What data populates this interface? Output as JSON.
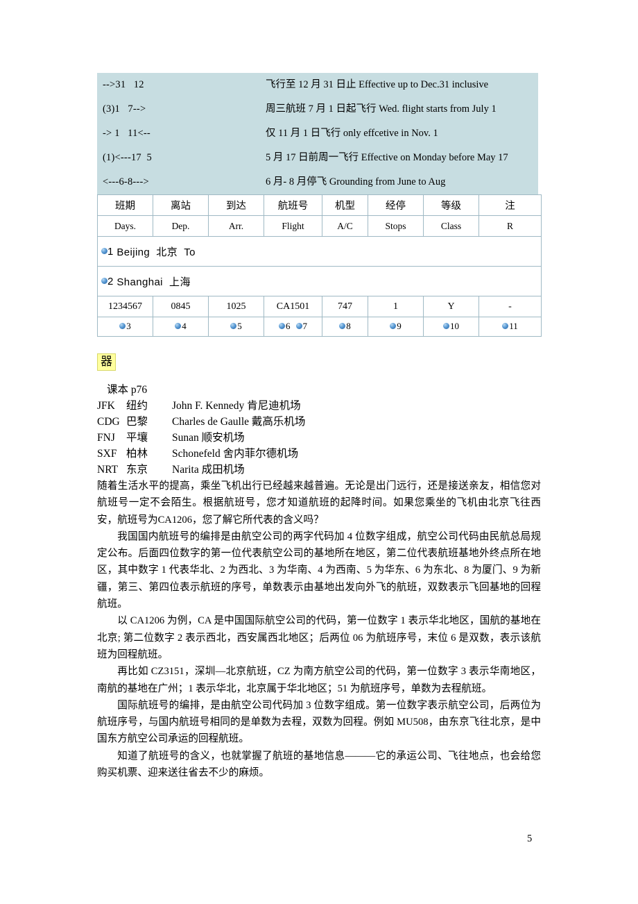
{
  "legend": {
    "rows": [
      {
        "code": "-->31   12",
        "desc": "飞行至 12 月 31 日止  Effective up to Dec.31 inclusive"
      },
      {
        "code": "(3)1   7-->",
        "desc": "周三航班 7 月 1 日起飞行  Wed. flight starts from July 1"
      },
      {
        "code": "-> 1   11<--",
        "desc": "仅 11 月 1 日飞行  only effcetive in Nov. 1"
      },
      {
        "code": "(1)<---17  5",
        "desc": "5 月 17 日前周一飞行  Effective on Monday before May 17"
      },
      {
        "code": "<---6-8--->",
        "desc": "6 月- 8 月停飞  Grounding from June to Aug"
      }
    ]
  },
  "table": {
    "headers_cn": [
      "班期",
      "离站",
      "到达",
      "航班号",
      "机型",
      "经停",
      "等级",
      "注"
    ],
    "headers_en": [
      "Days.",
      "Dep.",
      "Arr.",
      "Flight",
      "A/C",
      "Stops",
      "Class",
      "R"
    ],
    "origin_row": {
      "marker": "1",
      "text": "Beijing  北京  To"
    },
    "destination_row": {
      "marker": "2",
      "text": "Shanghai  上海"
    },
    "data_row": [
      "1234567",
      "0845",
      "1025",
      "CA1501",
      "747",
      "1",
      "Y",
      "-"
    ],
    "marker_row": [
      "3",
      "4",
      "5",
      "6",
      "7",
      "8",
      "9",
      "10",
      "11"
    ]
  },
  "icon": {
    "glyph": "器",
    "bg": "#ffff9e"
  },
  "codes": {
    "book_ref": "课本 p76",
    "items": [
      {
        "abbr": "JFK",
        "city": "纽约",
        "full": "John F. Kennedy  肯尼迪机场"
      },
      {
        "abbr": "CDG",
        "city": "巴黎",
        "full": "Charles de Gaulle  戴高乐机场"
      },
      {
        "abbr": "FNJ",
        "city": "平壤",
        "full": "Sunan  顺安机场"
      },
      {
        "abbr": "SXF",
        "city": "柏林",
        "full": "Schonefeld 舍内菲尔德机场"
      },
      {
        "abbr": "NRT",
        "city": "东京",
        "full": "Narita  成田机场"
      }
    ]
  },
  "article": {
    "paragraphs": [
      "随着生活水平的提高，乘坐飞机出行已经越来越普遍。无论是出门远行，还是接送亲友，相信您对航班号一定不会陌生。根据航班号，您才知道航班的起降时间。如果您乘坐的飞机由北京飞往西安，航班号为CA1206，您了解它所代表的含义吗？",
      "我国国内航班号的编排是由航空公司的两字代码加 4 位数字组成，航空公司代码由民航总局规定公布。后面四位数字的第一位代表航空公司的基地所在地区，第二位代表航班基地外终点所在地区，其中数字 1 代表华北、2 为西北、3 为华南、4 为西南、5 为华东、6 为东北、8 为厦门、9 为新疆，第三、第四位表示航班的序号，单数表示由基地出发向外飞的航班，双数表示飞回基地的回程航班。",
      "以 CA1206 为例，CA 是中国国际航空公司的代码，第一位数字 1 表示华北地区，国航的基地在北京; 第二位数字 2 表示西北，西安属西北地区；后两位 06 为航班序号，末位 6 是双数，表示该航班为回程航班。",
      "再比如 CZ3151，深圳—北京航班，CZ 为南方航空公司的代码，第一位数字 3 表示华南地区，南航的基地在广州；1 表示华北，北京属于华北地区；51 为航班序号，单数为去程航班。",
      "国际航班号的编排，是由航空公司代码加 3 位数字组成。第一位数字表示航空公司，后两位为航班序号，与国内航班号相同的是单数为去程，双数为回程。例如 MU508，由东京飞往北京，是中国东方航空公司承运的回程航班。",
      "知道了航班号的含义，也就掌握了航班的基地信息———它的承运公司、飞往地点，也会给您购买机票、迎来送往省去不少的麻烦。"
    ]
  },
  "footer": {
    "page_number": "5"
  }
}
